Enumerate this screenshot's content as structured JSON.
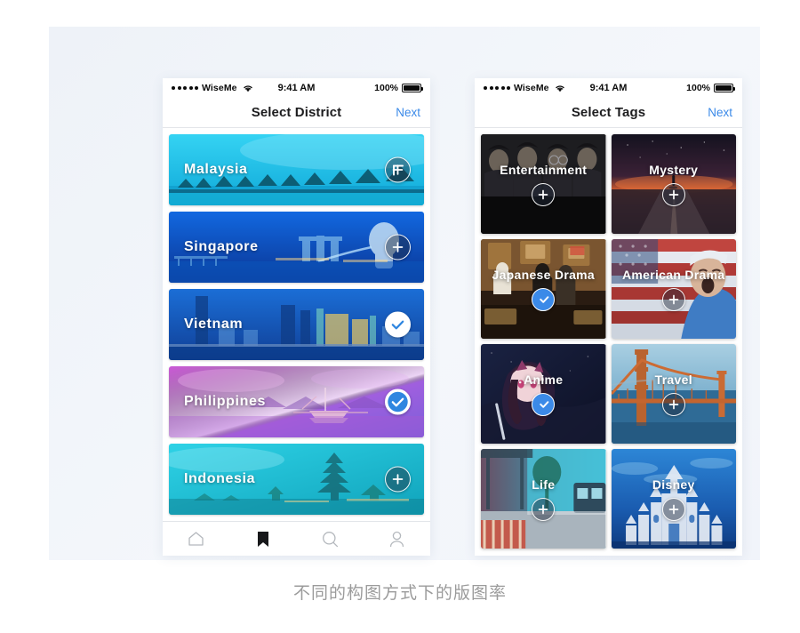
{
  "caption": "不同的构图方式下的版图率",
  "status_bar": {
    "carrier": "WiseMe",
    "time": "9:41 AM",
    "battery_percent": "100%",
    "signal_icon": "signal-dots-icon",
    "wifi_icon": "wifi-icon",
    "battery_icon": "battery-full-icon"
  },
  "screen_district": {
    "title": "Select District",
    "next_label": "Next",
    "cards": [
      {
        "name": "Malaysia",
        "state": "add",
        "icon": "plus-icon",
        "c1": "#2ec8ef",
        "c2": "#16a6dd",
        "scene": "stilt-houses"
      },
      {
        "name": "Singapore",
        "state": "add",
        "icon": "plus-icon",
        "c1": "#1565d8",
        "c2": "#0b3fae",
        "scene": "marina-bay"
      },
      {
        "name": "Vietnam",
        "state": "selected",
        "icon": "check-icon",
        "c1": "#1f63c9",
        "c2": "#1349a8",
        "scene": "city-skyline"
      },
      {
        "name": "Philippines",
        "state": "selected",
        "icon": "check-icon",
        "c1": "#c455d6",
        "c2": "#7b5fe0",
        "scene": "boat-lagoon"
      },
      {
        "name": "Indonesia",
        "state": "add",
        "icon": "plus-icon",
        "c1": "#25c7d8",
        "c2": "#1aa6bf",
        "scene": "bali-temple"
      }
    ],
    "tabs": [
      {
        "name": "home",
        "icon": "home-icon",
        "active": false
      },
      {
        "name": "bookmark",
        "icon": "bookmark-icon",
        "active": true
      },
      {
        "name": "search",
        "icon": "search-icon",
        "active": false
      },
      {
        "name": "profile",
        "icon": "person-icon",
        "active": false
      }
    ]
  },
  "screen_tags": {
    "title": "Select Tags",
    "next_label": "Next",
    "tags": [
      {
        "name": "Entertainment",
        "state": "add",
        "icon": "plus-icon",
        "c1": "#2a2a2c",
        "c2": "#0a0a0b",
        "scene": "group-portrait"
      },
      {
        "name": "Mystery",
        "state": "add",
        "icon": "plus-icon",
        "c1": "#2c2433",
        "c2": "#120f18",
        "scene": "dark-road"
      },
      {
        "name": "Japanese Drama",
        "state": "selected",
        "icon": "check-icon",
        "c1": "#7a5a33",
        "c2": "#241a10",
        "scene": "izakaya"
      },
      {
        "name": "American Drama",
        "state": "add",
        "icon": "plus-icon",
        "c1": "#b8443f",
        "c2": "#2e5a8c",
        "scene": "us-flag-fan"
      },
      {
        "name": "Anime",
        "state": "selected",
        "icon": "check-icon",
        "c1": "#3a2450",
        "c2": "#10162e",
        "scene": "anime-girl"
      },
      {
        "name": "Travel",
        "state": "add",
        "icon": "plus-icon",
        "c1": "#d2603a",
        "c2": "#3d7fae",
        "scene": "golden-gate"
      },
      {
        "name": "Life",
        "state": "add",
        "icon": "plus-icon",
        "c1": "#3aa8c4",
        "c2": "#1f4f6b",
        "scene": "street-bus"
      },
      {
        "name": "Disney",
        "state": "add",
        "icon": "plus-icon",
        "c1": "#2f7fd1",
        "c2": "#123b74",
        "scene": "castle"
      }
    ]
  },
  "colors": {
    "accent_blue": "#3b8ae8",
    "panel_bg": "#f1f4fa",
    "caption_gray": "#9b9b9b"
  }
}
